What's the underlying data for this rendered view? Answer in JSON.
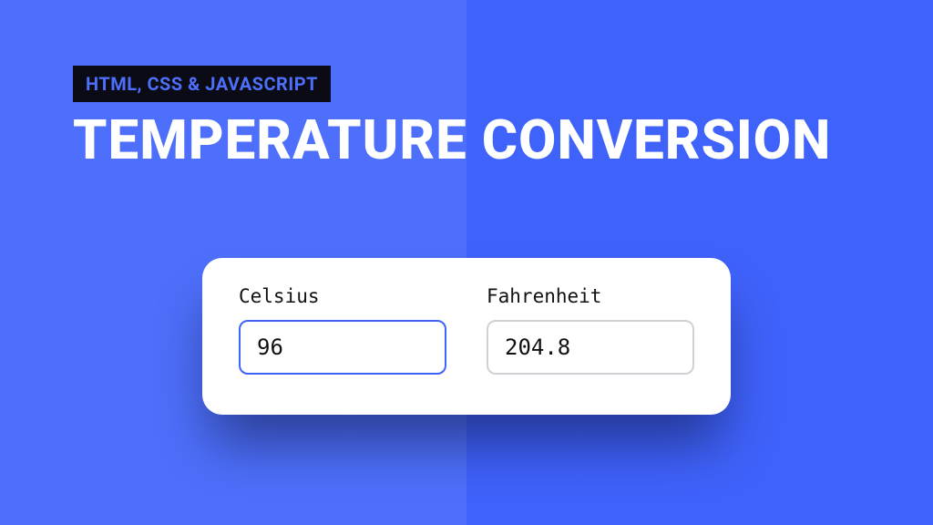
{
  "header": {
    "badge": "HTML, CSS & JAVASCRIPT",
    "title": "TEMPERATURE CONVERSION"
  },
  "converter": {
    "celsius": {
      "label": "Celsius",
      "value": "96",
      "focused": true
    },
    "fahrenheit": {
      "label": "Fahrenheit",
      "value": "204.8",
      "focused": false
    }
  },
  "colors": {
    "bg_left": "#4d6ffb",
    "bg_right": "#3f62fb",
    "badge_bg": "#0b0b15",
    "badge_text": "#4d6ffb",
    "title_text": "#ffffff",
    "card_bg": "#ffffff",
    "input_border": "#d0d0d7",
    "input_focus_border": "#3f62fb"
  }
}
